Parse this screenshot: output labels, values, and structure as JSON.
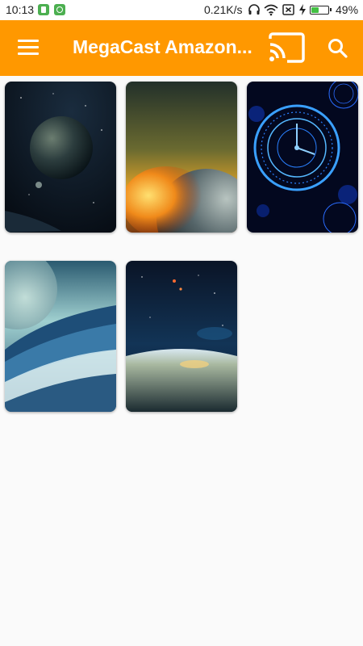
{
  "status_bar": {
    "time": "10:13",
    "network_speed": "0.21K/s",
    "battery_percent": "49%",
    "battery_level": 0.49,
    "icons": [
      "sim-icon",
      "android-icon",
      "headset-icon",
      "wifi-icon",
      "no-sim-icon",
      "charging-icon",
      "battery-icon"
    ]
  },
  "app_bar": {
    "title": "MegaCast Amazon...",
    "background_color": "#ff9800",
    "icons": [
      "menu-icon",
      "cast-icon",
      "search-icon"
    ]
  },
  "gallery": {
    "items": [
      {
        "name": "Planet in space",
        "colors": [
          "#0a1420",
          "#1d3a4a"
        ]
      },
      {
        "name": "Burning planet",
        "colors": [
          "#f2b624",
          "#2a3a40"
        ]
      },
      {
        "name": "Blue clock",
        "colors": [
          "#0a1a55",
          "#2a80ff"
        ]
      },
      {
        "name": "Planet over clouds",
        "colors": [
          "#9fd0d8",
          "#2a5a80"
        ]
      },
      {
        "name": "Earth from orbit",
        "colors": [
          "#0a1830",
          "#c0b080"
        ]
      }
    ]
  }
}
